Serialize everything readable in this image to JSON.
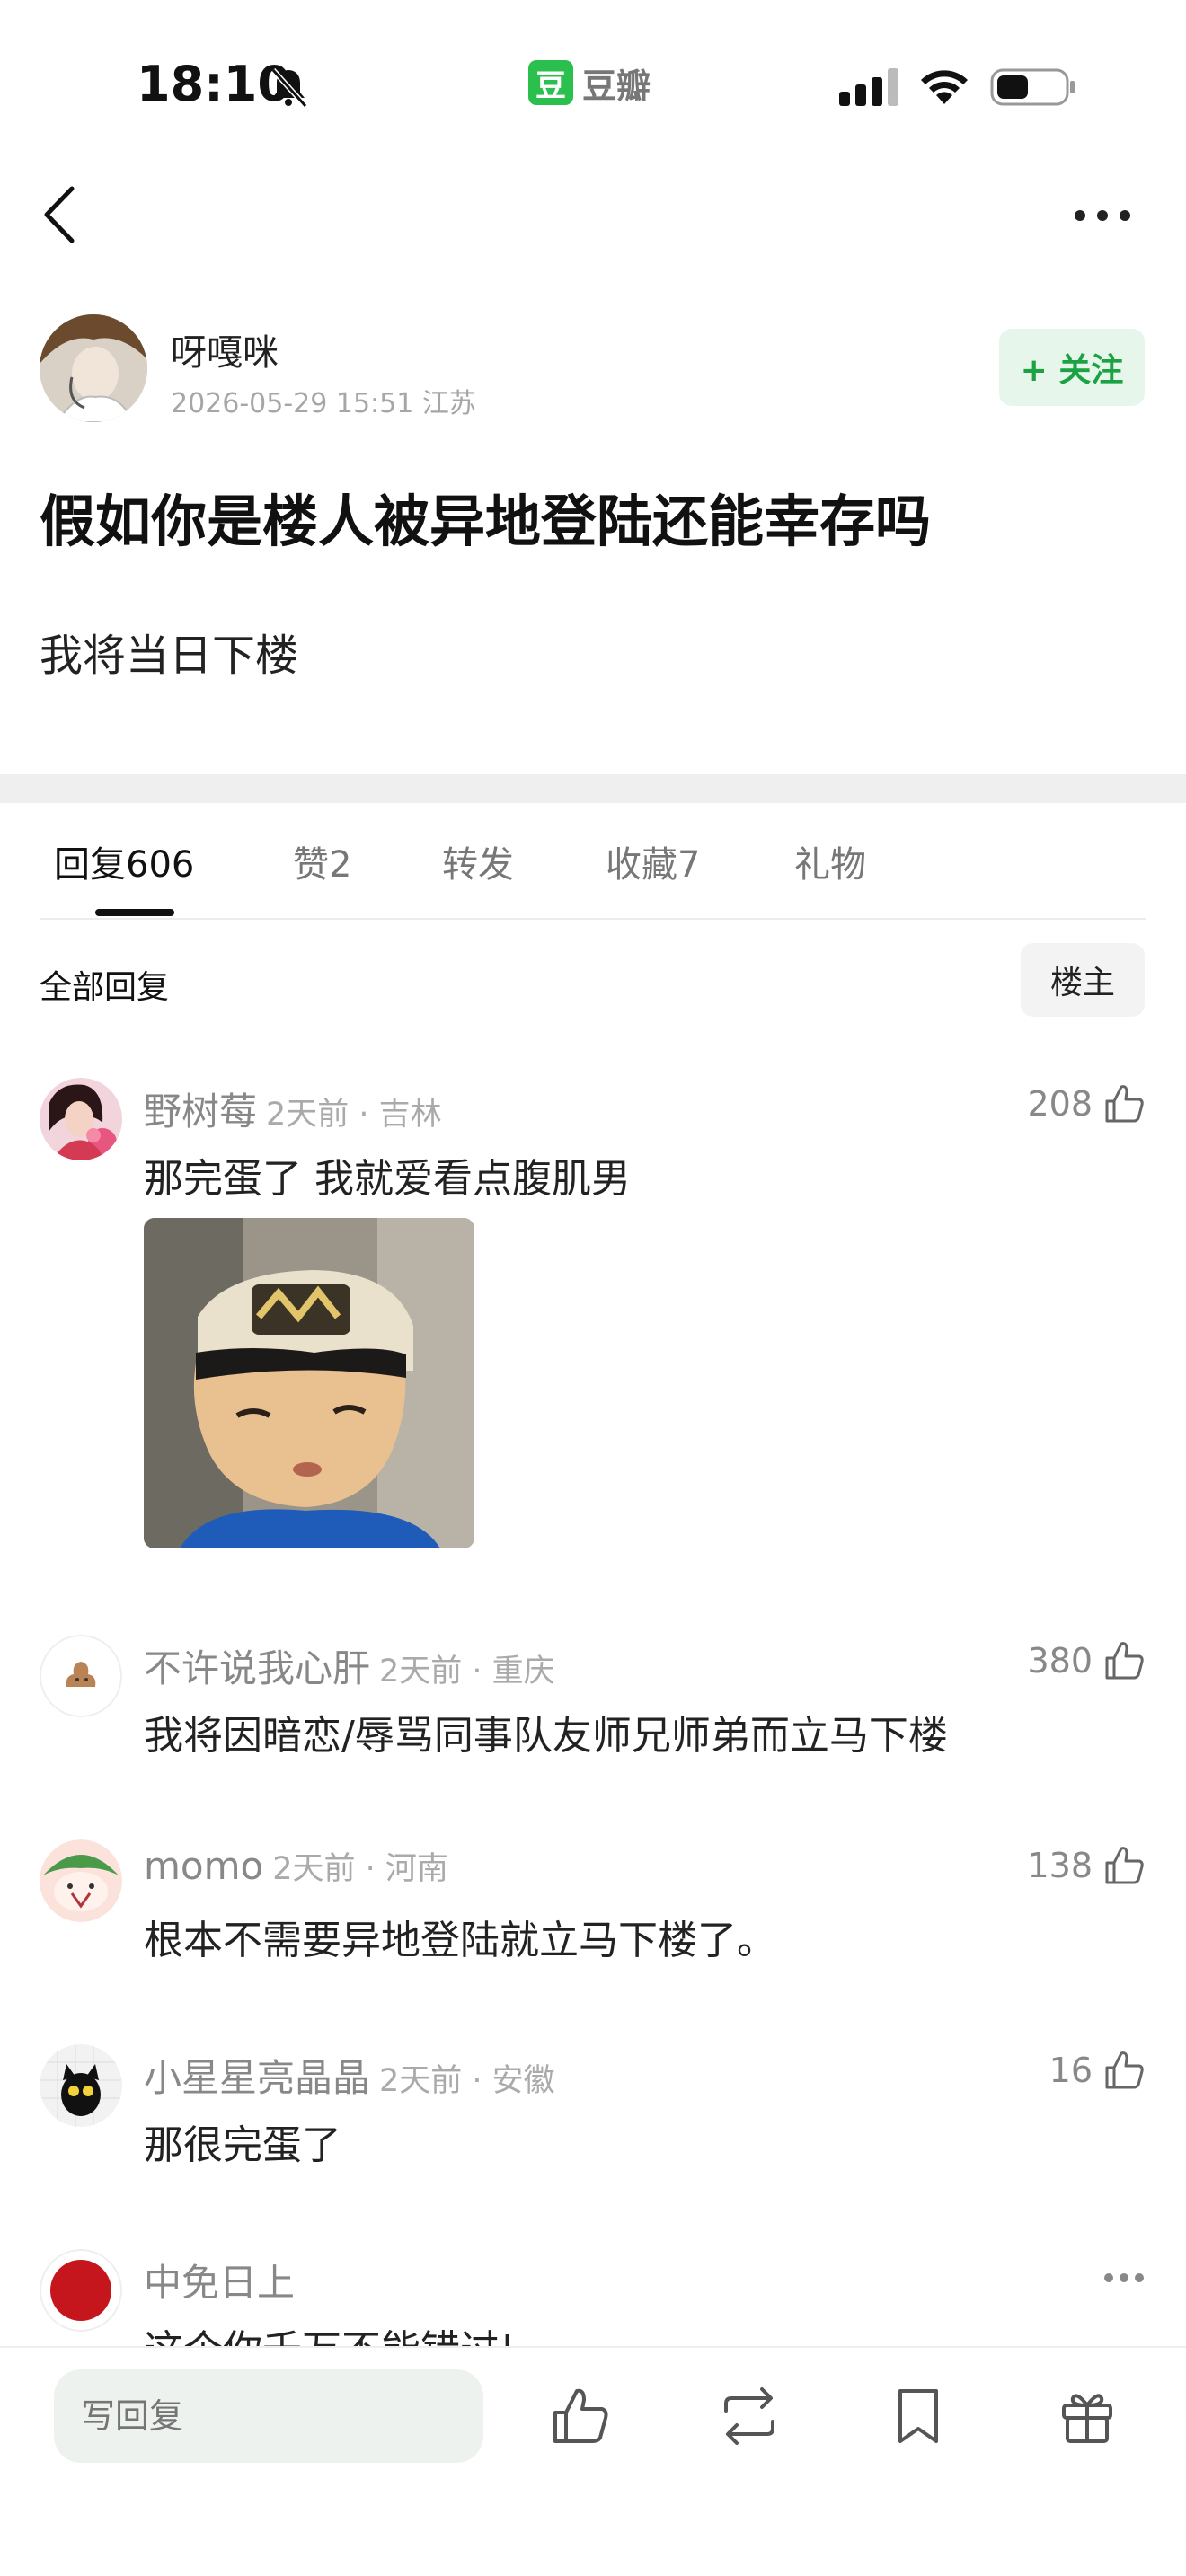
{
  "status_bar": {
    "time": "18:10",
    "app_logo": "豆",
    "app_name": "豆瓣"
  },
  "author": {
    "name": "呀嘎咪",
    "meta": "2026-05-29 15:51  江苏",
    "follow_label": "+ 关注"
  },
  "post": {
    "title": "假如你是楼人被异地登陆还能幸存吗",
    "body": "我将当日下楼"
  },
  "tabs": [
    {
      "label": "回复",
      "count": "606"
    },
    {
      "label": "赞",
      "count": "2"
    },
    {
      "label": "转发",
      "count": ""
    },
    {
      "label": "收藏",
      "count": "7"
    },
    {
      "label": "礼物",
      "count": ""
    }
  ],
  "section": {
    "title": "全部回复",
    "owner_button": "楼主"
  },
  "comments": [
    {
      "name": "野树莓",
      "meta": "2天前 · 吉林",
      "likes": "208",
      "text": "那完蛋了 我就爱看点腹肌男"
    },
    {
      "name": "不许说我心肝",
      "meta": "2天前 · 重庆",
      "likes": "380",
      "text": "我将因暗恋/辱骂同事队友师兄师弟而立马下楼"
    },
    {
      "name": "momo",
      "meta": "2天前 · 河南",
      "likes": "138",
      "text": "根本不需要异地登陆就立马下楼了。"
    },
    {
      "name": "小星星亮晶晶",
      "meta": "2天前 · 安徽",
      "likes": "16",
      "text": "那很完蛋了"
    },
    {
      "name": "中免日上",
      "meta": "",
      "likes": "",
      "text": "这个你千万不能错过!"
    }
  ],
  "ad_avatar_text": "中免日上",
  "bottom_bar": {
    "reply_placeholder": "写回复"
  },
  "icons": [
    "bell-slash-icon",
    "signal-icon",
    "wifi-icon",
    "battery-icon",
    "back-icon",
    "more-icon",
    "thumb-up-icon",
    "repost-icon",
    "bookmark-icon",
    "gift-icon",
    "more-dots-icon"
  ],
  "colors": {
    "accent": "#1aa243",
    "follow_bg": "#e7f6ea",
    "douban_green": "#2bbf4e"
  }
}
